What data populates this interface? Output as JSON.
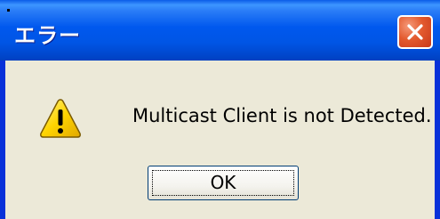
{
  "window": {
    "title": "エラー",
    "close_icon": "close-icon"
  },
  "dialog": {
    "icon": "warning-icon",
    "message": "Multicast Client is not Detected.",
    "ok_label": "OK"
  },
  "colors": {
    "titlebar": "#0058ee",
    "body": "#ece9d8",
    "close_button": "#e35a2e",
    "warning_yellow": "#ffd400"
  }
}
